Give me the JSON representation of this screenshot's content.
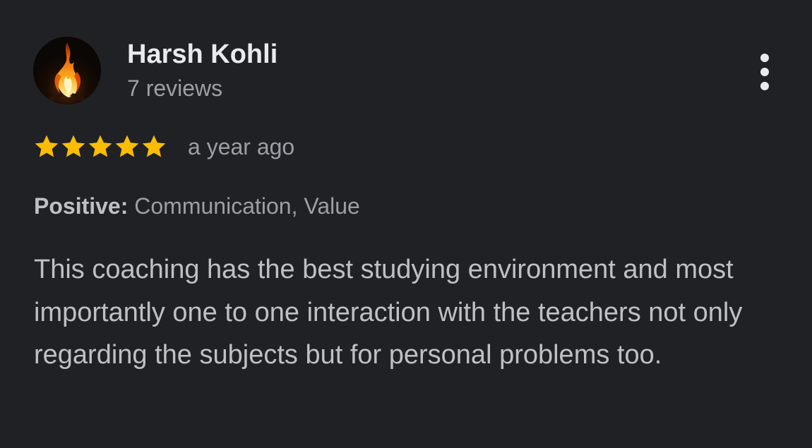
{
  "review": {
    "author": {
      "name": "Harsh Kohli",
      "reviews_count": "7 reviews",
      "avatar_icon": "fire-avatar-icon"
    },
    "menu_icon": "more-vertical-icon",
    "rating": {
      "stars": 5,
      "max_stars": 5,
      "star_color": "#fbbc04"
    },
    "time": "a year ago",
    "attributes": {
      "label": "Positive:",
      "values": "Communication, Value"
    },
    "text": "This coaching has the best studying environment and most importantly one to one interaction with the teachers not only regarding the subjects but for personal problems too."
  },
  "colors": {
    "background": "#202124",
    "name": "#e8eaed",
    "secondary_text": "#9aa0a6",
    "body_text": "#bdc1c6"
  }
}
